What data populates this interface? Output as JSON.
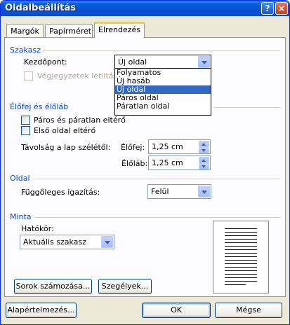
{
  "window": {
    "title": "Oldalbeállítás",
    "help_icon": "?",
    "close_icon": "×"
  },
  "tabs": [
    {
      "label": "Margók",
      "active": false
    },
    {
      "label": "Papírméret",
      "active": false
    },
    {
      "label": "Elrendezés",
      "active": true
    }
  ],
  "section": {
    "title": "Szakasz",
    "start_label": "Kezdőpont:",
    "start_value": "Új oldal",
    "suppress_endnotes_label": "Végjegyzetek letiltása",
    "suppress_endnotes_checked": false,
    "options": [
      "Folyamatos",
      "Új hasáb",
      "Új oldal",
      "Páros oldal",
      "Páratlan oldal"
    ],
    "selected_option": "Új oldal"
  },
  "headers_footers": {
    "title": "Élőfej és élőláb",
    "odd_even_label": "Páros és páratlan eltérő",
    "odd_even_checked": false,
    "first_page_label": "Első oldal eltérő",
    "first_page_checked": false,
    "distance_label": "Távolság a lap szélétől:",
    "header_label": "Élőfej:",
    "header_value": "1,25 cm",
    "footer_label": "Élőláb:",
    "footer_value": "1,25 cm"
  },
  "page": {
    "title": "Oldal",
    "valign_label": "Függőleges igazítás:",
    "valign_value": "Felül"
  },
  "preview": {
    "title": "Minta",
    "apply_to_label": "Hatókör:",
    "apply_to_value": "Aktuális szakasz"
  },
  "buttons": {
    "line_numbers": "Sorok számozása...",
    "borders": "Szegélyek...",
    "default": "Alapértelmezés...",
    "ok": "OK",
    "cancel": "Mégse"
  },
  "colors": {
    "title_bar": "#0a5fdb",
    "section_title": "#0046d5",
    "selection": "#316ac5",
    "tab_highlight": "#ffc73c"
  }
}
